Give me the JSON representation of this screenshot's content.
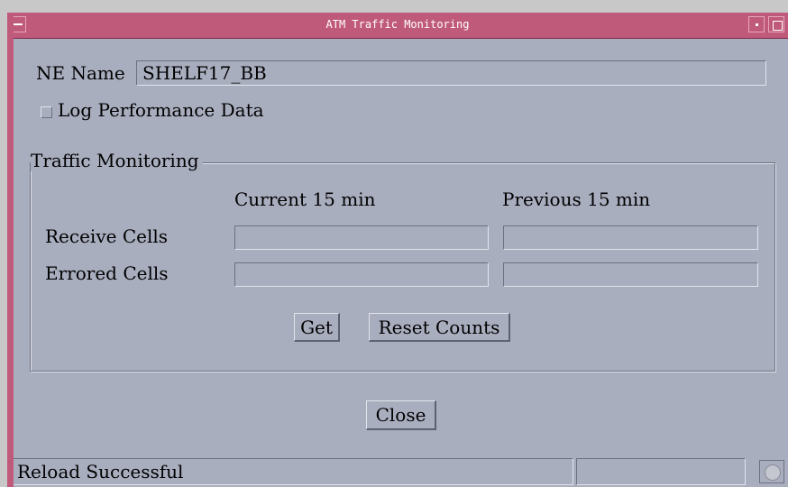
{
  "window": {
    "title": "ATM Traffic  Monitoring"
  },
  "ne_name": {
    "label": "NE Name",
    "value": "SHELF17_BB"
  },
  "log_performance": {
    "label": "Log Performance Data",
    "checked": false
  },
  "traffic_group": {
    "title": "Traffic Monitoring",
    "col_current": "Current 15 min",
    "col_previous": "Previous 15 min",
    "rows": [
      {
        "label": "Receive Cells",
        "current": "",
        "previous": ""
      },
      {
        "label": "Errored Cells",
        "current": "",
        "previous": ""
      }
    ],
    "get_label": "Get",
    "reset_label": "Reset Counts"
  },
  "close_label": "Close",
  "status": {
    "message": "Reload Successful",
    "secondary": ""
  },
  "colors": {
    "titlebar": "#c05a7a",
    "background": "#a9aebf"
  }
}
